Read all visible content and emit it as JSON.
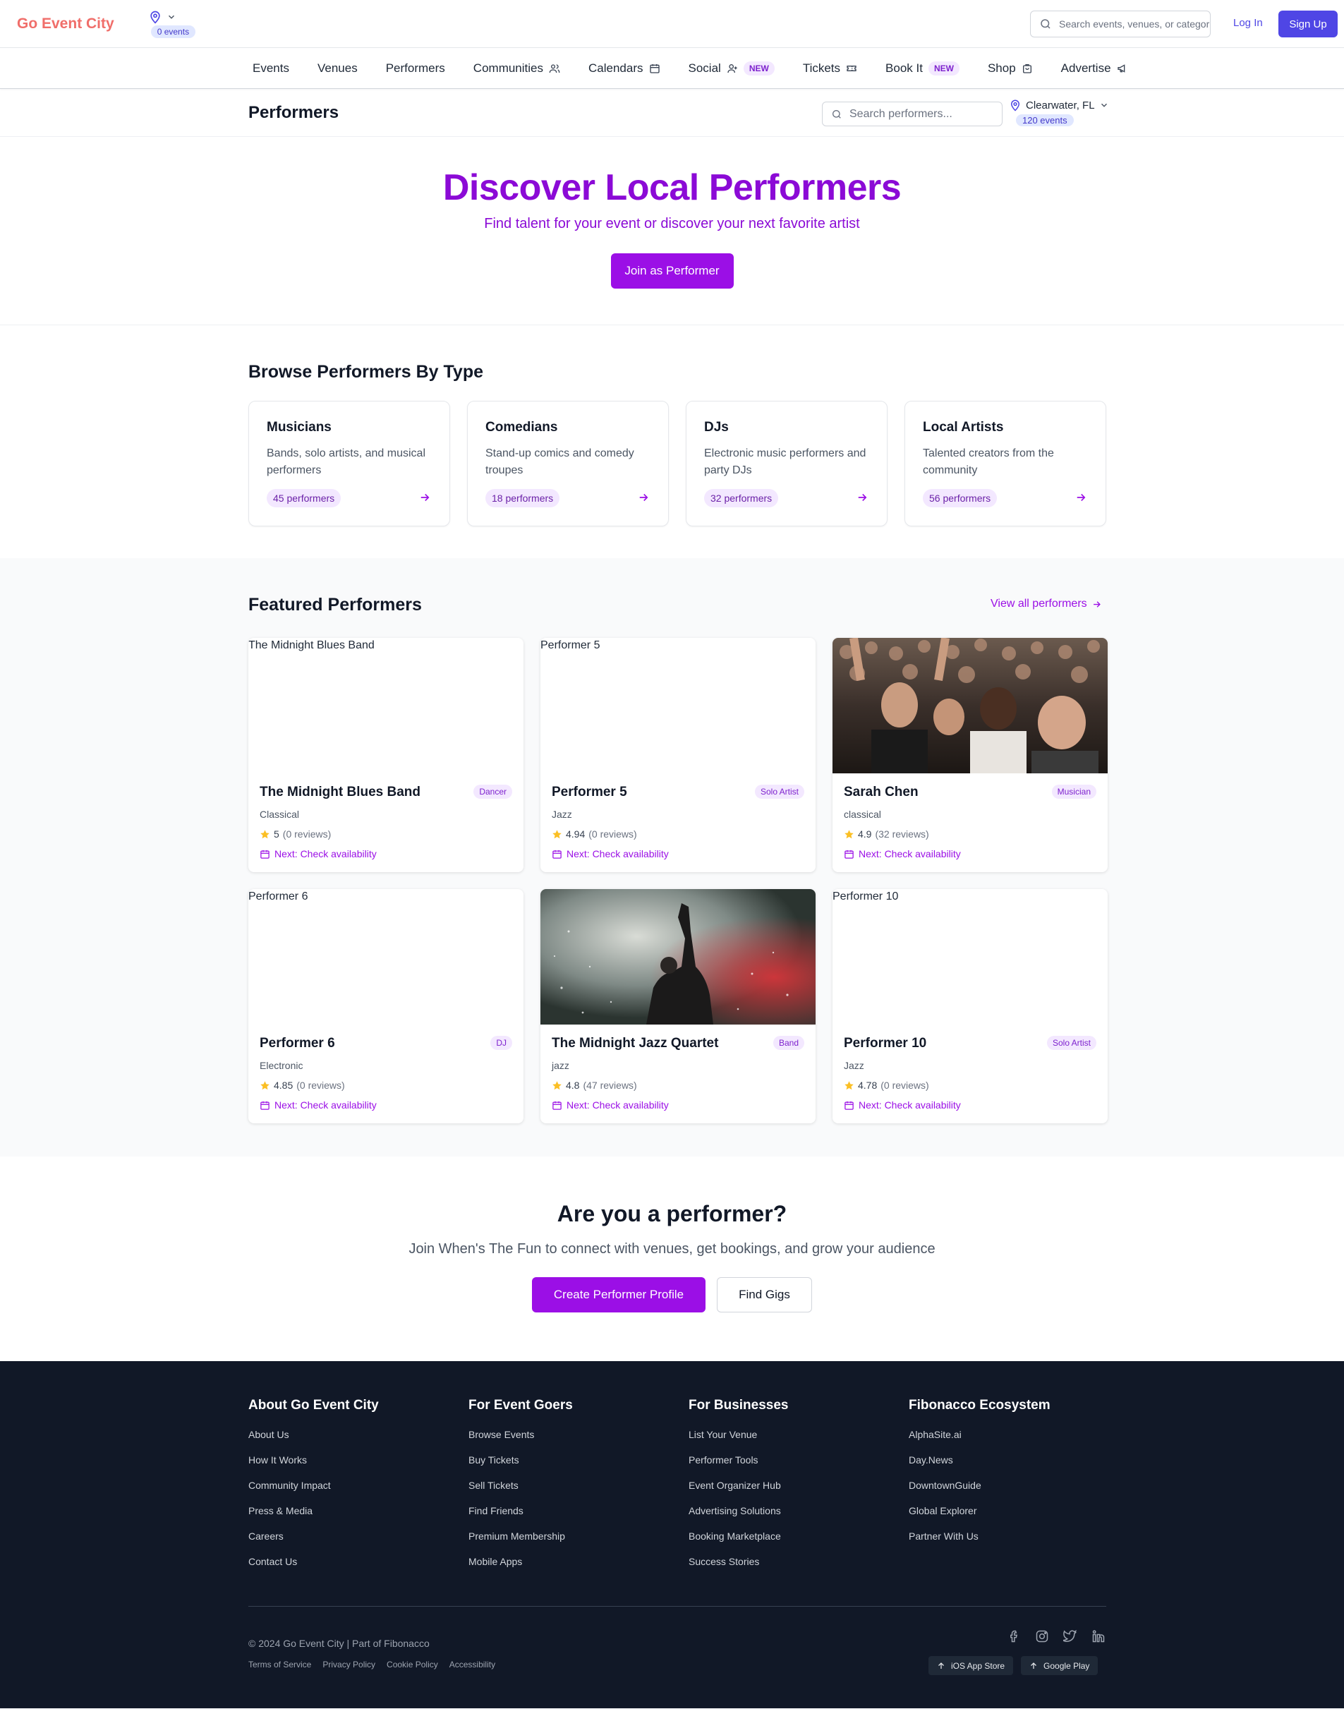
{
  "header": {
    "logo": "Go Event City",
    "location_count": "0 events",
    "search_placeholder": "Search events, venues, or categories",
    "login": "Log In",
    "signup": "Sign Up"
  },
  "nav": {
    "items": [
      {
        "label": "Events",
        "icon": "",
        "badge": ""
      },
      {
        "label": "Venues",
        "icon": "",
        "badge": ""
      },
      {
        "label": "Performers",
        "icon": "",
        "badge": ""
      },
      {
        "label": "Communities",
        "icon": "users-icon",
        "badge": ""
      },
      {
        "label": "Calendars",
        "icon": "calendar-icon",
        "badge": ""
      },
      {
        "label": "Social",
        "icon": "user-icon",
        "badge": "NEW"
      },
      {
        "label": "Tickets",
        "icon": "ticket-icon",
        "badge": ""
      },
      {
        "label": "Book It",
        "icon": "",
        "badge": "NEW"
      },
      {
        "label": "Shop",
        "icon": "bag-icon",
        "badge": ""
      },
      {
        "label": "Advertise",
        "icon": "megaphone-icon",
        "badge": ""
      }
    ]
  },
  "page": {
    "title": "Performers",
    "search_placeholder": "Search performers...",
    "location": "Clearwater, FL",
    "event_count": "120 events"
  },
  "hero": {
    "title": "Discover Local Performers",
    "subtitle": "Find talent for your event or discover your next favorite artist",
    "button": "Join as Performer"
  },
  "browse": {
    "heading": "Browse Performers By Type",
    "cards": [
      {
        "title": "Musicians",
        "description": "Bands, solo artists, and musical performers",
        "count": "45 performers"
      },
      {
        "title": "Comedians",
        "description": "Stand-up comics and comedy troupes",
        "count": "18 performers"
      },
      {
        "title": "DJs",
        "description": "Electronic music performers and party DJs",
        "count": "32 performers"
      },
      {
        "title": "Local Artists",
        "description": "Talented creators from the community",
        "count": "56 performers"
      }
    ]
  },
  "featured": {
    "heading": "Featured Performers",
    "view_all": "View all performers",
    "next_label": "Next: Check availability",
    "performers": [
      {
        "name": "The Midnight Blues Band",
        "type": "Dancer",
        "genre": "Classical",
        "rating": "5",
        "reviews": "(0 reviews)",
        "image": "broken",
        "alt": "The Midnight Blues Band"
      },
      {
        "name": "Performer 5",
        "type": "Solo Artist",
        "genre": "Jazz",
        "rating": "4.94",
        "reviews": "(0 reviews)",
        "image": "broken",
        "alt": "Performer 5"
      },
      {
        "name": "Sarah Chen",
        "type": "Musician",
        "genre": "classical",
        "rating": "4.9",
        "reviews": "(32 reviews)",
        "image": "crowd-photo",
        "alt": ""
      },
      {
        "name": "Performer 6",
        "type": "DJ",
        "genre": "Electronic",
        "rating": "4.85",
        "reviews": "(0 reviews)",
        "image": "broken",
        "alt": "Performer 6"
      },
      {
        "name": "The Midnight Jazz Quartet",
        "type": "Band",
        "genre": "jazz",
        "rating": "4.8",
        "reviews": "(47 reviews)",
        "image": "concert-photo",
        "alt": ""
      },
      {
        "name": "Performer 10",
        "type": "Solo Artist",
        "genre": "Jazz",
        "rating": "4.78",
        "reviews": "(0 reviews)",
        "image": "broken",
        "alt": "Performer 10"
      }
    ]
  },
  "cta": {
    "heading": "Are you a performer?",
    "text": "Join When's The Fun to connect with venues, get bookings, and grow your audience",
    "primary": "Create Performer Profile",
    "secondary": "Find Gigs"
  },
  "footer": {
    "columns": [
      {
        "title": "About Go Event City",
        "links": [
          "About Us",
          "How It Works",
          "Community Impact",
          "Press & Media",
          "Careers",
          "Contact Us"
        ]
      },
      {
        "title": "For Event Goers",
        "links": [
          "Browse Events",
          "Buy Tickets",
          "Sell Tickets",
          "Find Friends",
          "Premium Membership",
          "Mobile Apps"
        ]
      },
      {
        "title": "For Businesses",
        "links": [
          "List Your Venue",
          "Performer Tools",
          "Event Organizer Hub",
          "Advertising Solutions",
          "Booking Marketplace",
          "Success Stories"
        ]
      },
      {
        "title": "Fibonacco Ecosystem",
        "links": [
          "AlphaSite.ai",
          "Day.News",
          "DowntownGuide",
          "Global Explorer",
          "Partner With Us"
        ]
      }
    ],
    "copyright": "© 2024 Go Event City | Part of Fibonacco",
    "legal": [
      "Terms of Service",
      "Privacy Policy",
      "Cookie Policy",
      "Accessibility"
    ],
    "social": [
      "facebook-icon",
      "instagram-icon",
      "twitter-icon",
      "linkedin-icon"
    ],
    "stores": [
      "iOS App Store",
      "Google Play"
    ]
  },
  "colors": {
    "brand": "#f06e6a",
    "accent_indigo": "#4f46e5",
    "accent_purple": "#9b0fe6",
    "footer_bg": "#111827",
    "star": "#fbbf24"
  }
}
